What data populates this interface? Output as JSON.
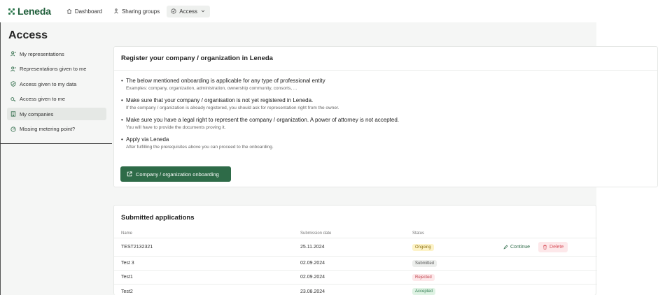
{
  "app": {
    "name": "Leneda"
  },
  "nav": {
    "items": [
      {
        "label": "Dashboard",
        "icon": "home-icon"
      },
      {
        "label": "Sharing groups",
        "icon": "share-icon"
      },
      {
        "label": "Access",
        "icon": "access-icon"
      }
    ]
  },
  "page": {
    "title": "Access"
  },
  "sidebar": {
    "items": [
      {
        "label": "My representations",
        "icon": "user-icon"
      },
      {
        "label": "Representations given to me",
        "icon": "user-icon"
      },
      {
        "label": "Access given to my data",
        "icon": "shield-icon"
      },
      {
        "label": "Access given to me",
        "icon": "key-icon"
      },
      {
        "label": "My companies",
        "icon": "building-icon"
      },
      {
        "label": "Missing metering point?",
        "icon": "meter-icon"
      }
    ]
  },
  "register": {
    "title": "Register your company / organization in Leneda",
    "bullets": [
      {
        "main": "The below mentioned onboarding is applicable for any type of professional entity",
        "sub": "Examples: company, organization, administration, ownership community, consorts, ..."
      },
      {
        "main": "Make sure that your company / organisation is not yet registered in Leneda.",
        "sub": "If the company / organization is already registered, you should ask for representation right from the owner."
      },
      {
        "main": "Make sure you have a legal right to represent the company / organization. A power of attorney is not accepted.",
        "sub": "You will have to provide the documents proving it."
      },
      {
        "main": "Apply via Leneda",
        "sub": "After fulfilling the prerequisites above you can proceed to the onboarding."
      }
    ],
    "button_label": "Company / organization onboarding"
  },
  "applications": {
    "title": "Submitted applications",
    "columns": {
      "name": "Name",
      "date": "Submission date",
      "status": "Status"
    },
    "rows": [
      {
        "name": "TEST2132321",
        "date": "25.11.2024",
        "status": "Ongoing",
        "status_bg": "#fdf3c8",
        "status_fg": "#8a6d0b"
      },
      {
        "name": "Test 3",
        "date": "02.09.2024",
        "status": "Submitted",
        "status_bg": "#eceeec",
        "status_fg": "#555555"
      },
      {
        "name": "Test1",
        "date": "02.09.2024",
        "status": "Rejected",
        "status_bg": "#fde8ea",
        "status_fg": "#c0444e"
      },
      {
        "name": "Test2",
        "date": "23.08.2024",
        "status": "Accepted",
        "status_bg": "#dff3e4",
        "status_fg": "#2e7a4f"
      }
    ],
    "actions": {
      "continue_label": "Continue",
      "delete_label": "Delete"
    }
  },
  "colors": {
    "brand": "#2e6b48",
    "delete": "#d9555f",
    "background": "#f5f6f5"
  }
}
